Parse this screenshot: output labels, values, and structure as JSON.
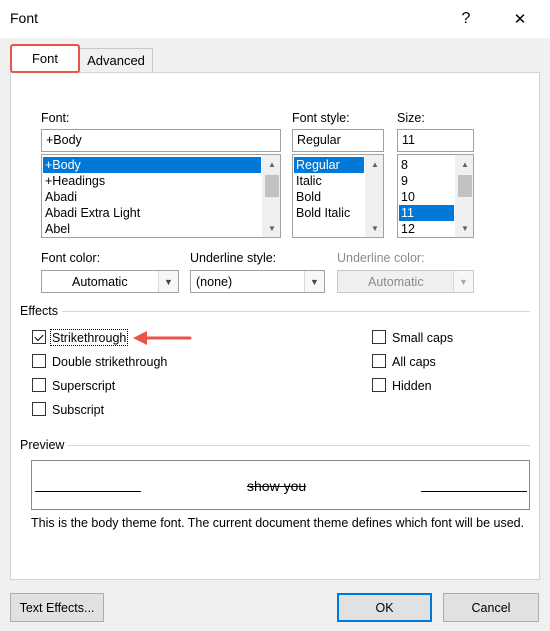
{
  "window": {
    "title": "Font",
    "help_glyph": "?",
    "close_glyph": "✕"
  },
  "tabs": [
    {
      "label": "Font",
      "active": true
    },
    {
      "label": "Advanced",
      "active": false
    }
  ],
  "font": {
    "label": "Font:",
    "value": "+Body",
    "items": [
      "+Body",
      "+Headings",
      "Abadi",
      "Abadi Extra Light",
      "Abel"
    ],
    "selected": "+Body"
  },
  "font_style": {
    "label": "Font style:",
    "value": "Regular",
    "items": [
      "Regular",
      "Italic",
      "Bold",
      "Bold Italic"
    ],
    "selected": "Regular"
  },
  "size": {
    "label": "Size:",
    "value": "11",
    "items": [
      "8",
      "9",
      "10",
      "11",
      "12"
    ],
    "selected": "11"
  },
  "font_color": {
    "label": "Font color:",
    "value": "Automatic"
  },
  "underline_style": {
    "label": "Underline style:",
    "value": "(none)"
  },
  "underline_color": {
    "label": "Underline color:",
    "value": "Automatic",
    "disabled": true
  },
  "effects": {
    "label": "Effects",
    "left": [
      {
        "label": "Strikethrough",
        "checked": true
      },
      {
        "label": "Double strikethrough",
        "checked": false
      },
      {
        "label": "Superscript",
        "checked": false
      },
      {
        "label": "Subscript",
        "checked": false
      }
    ],
    "right": [
      {
        "label": "Small caps",
        "checked": false
      },
      {
        "label": "All caps",
        "checked": false
      },
      {
        "label": "Hidden",
        "checked": false
      }
    ]
  },
  "preview": {
    "label": "Preview",
    "sample": "show you",
    "note": "This is the body theme font. The current document theme defines which font will be used."
  },
  "buttons": {
    "text_effects": "Text Effects...",
    "ok": "OK",
    "cancel": "Cancel"
  },
  "colors": {
    "selection": "#0078d7",
    "annotation": "#e8534a"
  }
}
